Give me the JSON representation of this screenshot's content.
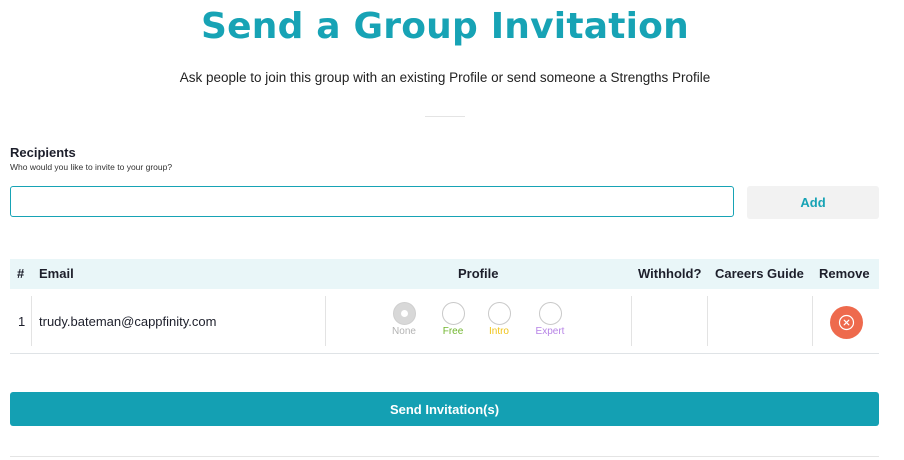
{
  "header": {
    "title": "Send a Group Invitation",
    "subtitle": "Ask people to join this group with an existing Profile or send someone a Strengths Profile"
  },
  "recipients": {
    "label": "Recipients",
    "help": "Who would you like to invite to your group?",
    "input_value": "",
    "add_label": "Add"
  },
  "table": {
    "headers": {
      "num": "#",
      "email": "Email",
      "profile": "Profile",
      "withhold": "Withhold?",
      "careers_guide": "Careers Guide",
      "remove": "Remove"
    },
    "rows": [
      {
        "num": "1",
        "email": "trudy.bateman@cappfinity.com",
        "selected_profile": "None",
        "profile_options": [
          {
            "label": "None",
            "color": "#b3b3b3"
          },
          {
            "label": "Free",
            "color": "#6fb52c"
          },
          {
            "label": "Intro",
            "color": "#f0c419"
          },
          {
            "label": "Expert",
            "color": "#b784e6"
          }
        ]
      }
    ]
  },
  "actions": {
    "send_label": "Send Invitation(s)"
  },
  "colors": {
    "accent": "#17a3b5",
    "remove": "#ee6a4d",
    "header_bg": "#e9f6f8"
  },
  "icons": {
    "remove": "close-circle-icon"
  }
}
